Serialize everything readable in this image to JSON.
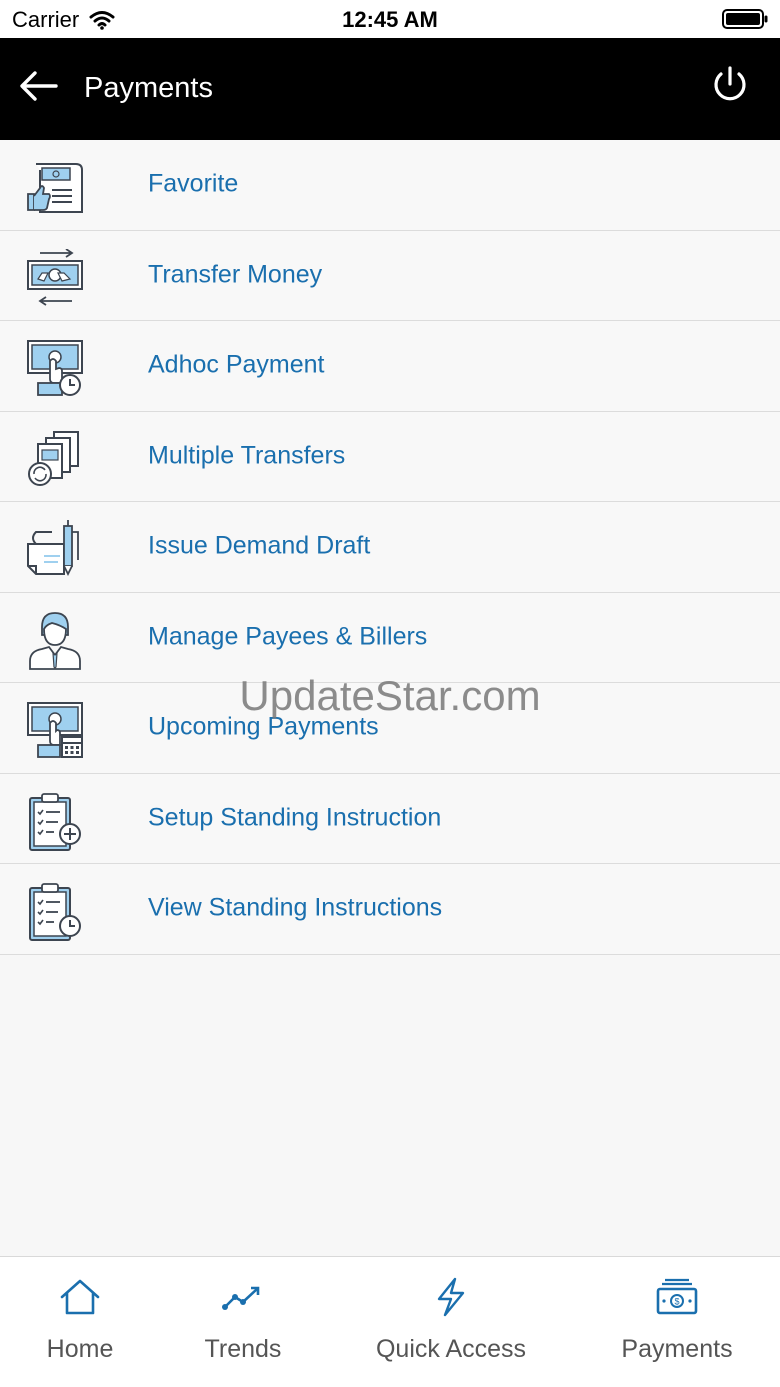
{
  "status_bar": {
    "carrier": "Carrier",
    "time": "12:45 AM"
  },
  "header": {
    "title": "Payments"
  },
  "menu": {
    "items": [
      {
        "label": "Favorite",
        "icon": "favorite-icon"
      },
      {
        "label": "Transfer Money",
        "icon": "transfer-money-icon"
      },
      {
        "label": "Adhoc Payment",
        "icon": "adhoc-payment-icon"
      },
      {
        "label": "Multiple Transfers",
        "icon": "multiple-transfers-icon"
      },
      {
        "label": "Issue Demand Draft",
        "icon": "demand-draft-icon"
      },
      {
        "label": "Manage Payees & Billers",
        "icon": "payee-person-icon"
      },
      {
        "label": "Upcoming Payments",
        "icon": "upcoming-payments-icon"
      },
      {
        "label": "Setup Standing Instruction",
        "icon": "clipboard-add-icon"
      },
      {
        "label": "View Standing Instructions",
        "icon": "clipboard-clock-icon"
      }
    ]
  },
  "watermark": "UpdateStar.com",
  "tabs": [
    {
      "label": "Home",
      "icon": "home-icon"
    },
    {
      "label": "Trends",
      "icon": "trends-icon"
    },
    {
      "label": "Quick Access",
      "icon": "lightning-icon"
    },
    {
      "label": "Payments",
      "icon": "banknote-icon"
    }
  ],
  "colors": {
    "accent": "#1a6fae",
    "header_bg": "#000000",
    "icon_light": "#9fd0ef",
    "icon_dark": "#3d4550"
  }
}
